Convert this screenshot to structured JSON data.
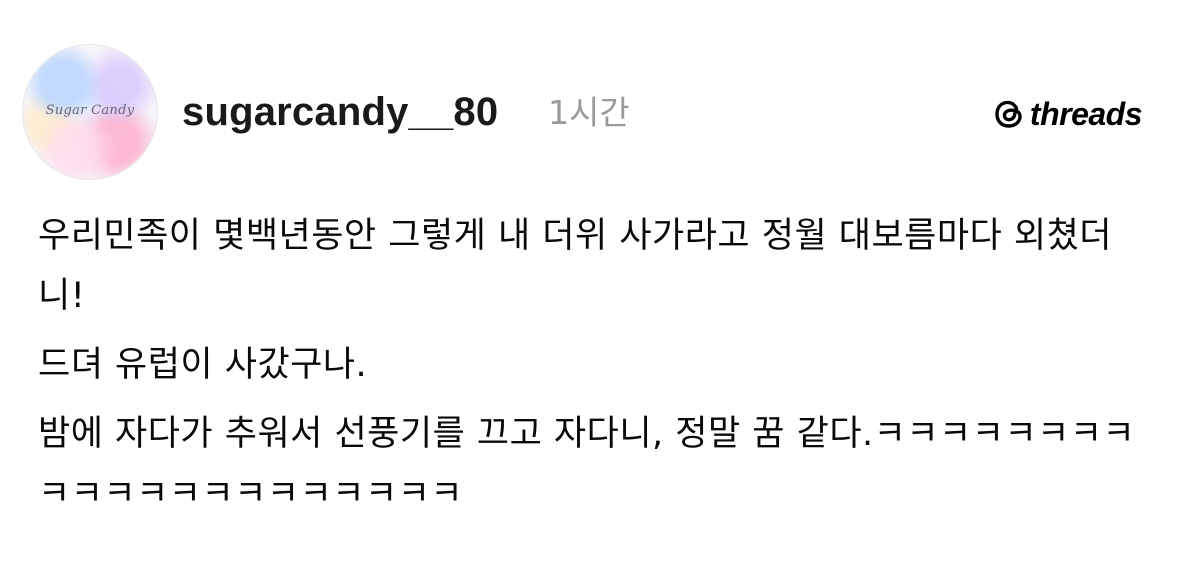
{
  "post": {
    "avatar_text": "Sugar Candy",
    "username": "sugarcandy__80",
    "time": "1시간",
    "brand": "threads",
    "brand_icon": "threads-logo-icon",
    "lines": [
      "우리민족이 몇백년동안 그렇게 내 더위 사가라고 정월 대보름마다 외쳤더니!",
      "드뎌 유럽이 사갔구나.",
      "밤에 자다가 추워서 선풍기를 끄고 자다니, 정말 꿈 같다.ㅋㅋㅋㅋㅋㅋㅋㅋㅋㅋㅋㅋㅋㅋㅋㅋㅋㅋㅋㅋㅋ"
    ]
  }
}
